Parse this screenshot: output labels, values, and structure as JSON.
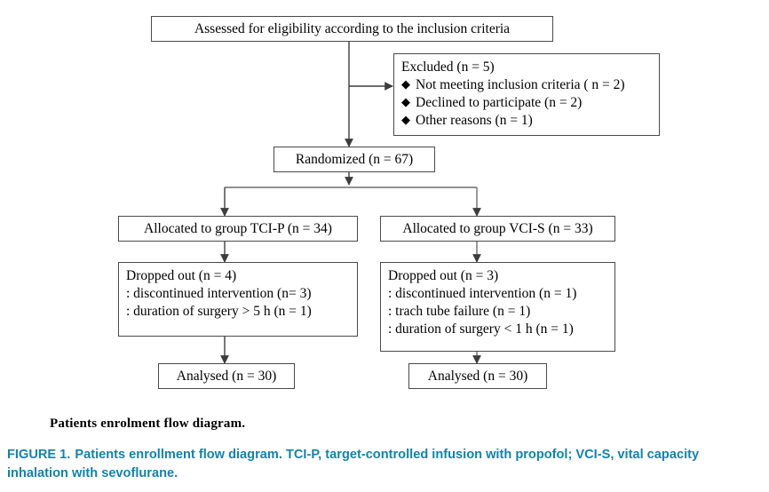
{
  "figure": {
    "nodes": {
      "assessed": "Assessed for eligibility according to the inclusion criteria",
      "excluded_title": "Excluded (n = 5)",
      "excluded_items": [
        "Not meeting inclusion criteria ( n = 2)",
        "Declined to participate (n = 2)",
        "Other reasons (n = 1)"
      ],
      "randomized": "Randomized (n = 67)",
      "allocated_left": "Allocated to group TCI-P (n = 34)",
      "allocated_right": "Allocated to group VCI-S (n = 33)",
      "dropped_left_title": "Dropped out (n = 4)",
      "dropped_left_items": [
        ": discontinued intervention (n= 3)",
        ": duration of surgery > 5 h (n = 1)"
      ],
      "dropped_right_title": "Dropped out (n = 3)",
      "dropped_right_items": [
        ": discontinued intervention (n = 1)",
        ": trach tube failure (n = 1)",
        ": duration of surgery < 1 h (n = 1)"
      ],
      "analysed_left": "Analysed (n = 30)",
      "analysed_right": "Analysed (n = 30)"
    },
    "bullet_glyph": "◆",
    "caption_plain": "Patients enrolment flow diagram.",
    "caption_figure_label": "FIGURE 1.",
    "caption_figure_text": "Patients enrollment flow diagram. TCI-P, target-controlled infusion with propofol; VCI-S, vital capacity inhalation with sevoflurane.",
    "colors": {
      "caption_accent": "#1283ac",
      "box_border": "#4a4a4a",
      "connector": "#3d3d3d",
      "text": "#000000",
      "background": "#ffffff"
    }
  }
}
